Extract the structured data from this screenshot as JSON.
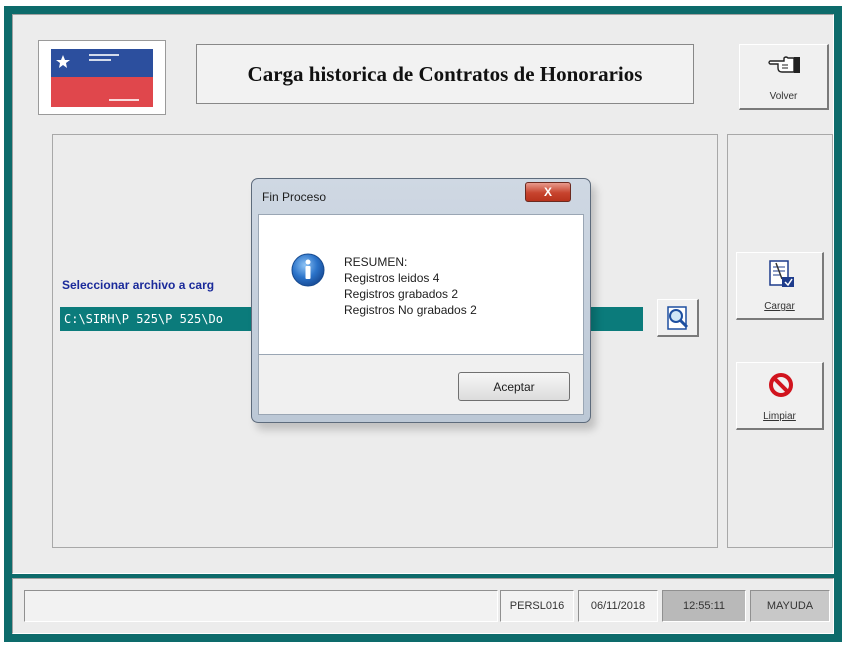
{
  "header": {
    "title": "Carga historica de Contratos de Honorarios",
    "volver_label": "Volver"
  },
  "form": {
    "file_label": "Seleccionar archivo a carg",
    "file_path": "C:\\SIRH\\P 525\\P 525\\Do"
  },
  "sidebar": {
    "cargar_label": "Cargar",
    "limpiar_label": "Limpiar"
  },
  "status_bar": {
    "code": "PERSL016",
    "date": "06/11/2018",
    "time": "12:55:11",
    "mode": "MAYUDA"
  },
  "dialog": {
    "title": "Fin Proceso",
    "heading": "RESUMEN:",
    "lines": [
      "Registros leidos 4",
      "Registros grabados 2",
      "Registros No grabados 2"
    ],
    "ok_label": "Aceptar",
    "close_label": "X"
  },
  "colors": {
    "frame": "#0d6b6b",
    "field": "#0b7b7b",
    "label_blue": "#1a2a9a"
  },
  "icons": {
    "volver": "pointing-hand-icon",
    "browse": "magnifier-icon",
    "cargar": "document-load-icon",
    "limpiar": "prohibition-icon",
    "dialog": "info-icon"
  }
}
